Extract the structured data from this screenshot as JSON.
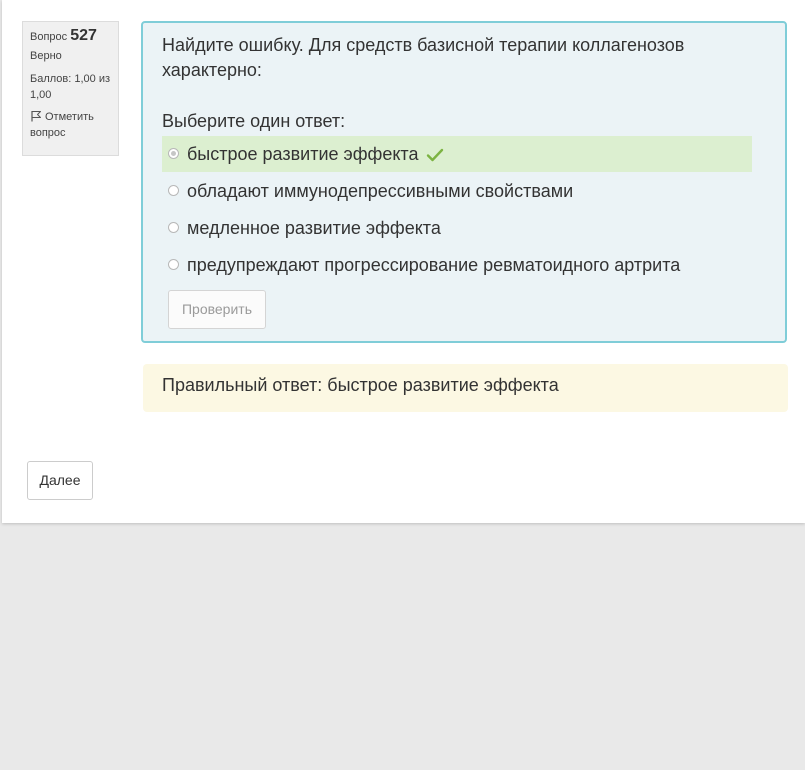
{
  "question_info": {
    "label": "Вопрос",
    "number": "527",
    "state": "Верно",
    "grade": "Баллов: 1,00 из 1,00",
    "flag_label": "Отметить вопрос"
  },
  "question": {
    "text": "Найдите ошибку. Для средств базисной терапии коллагенозов характерно:",
    "prompt": "Выберите один ответ:",
    "answers": [
      {
        "label": "быстрое развитие эффекта",
        "selected": true,
        "correct": true
      },
      {
        "label": "обладают иммунодепрессивными свойствами",
        "selected": false
      },
      {
        "label": "медленное развитие эффекта",
        "selected": false
      },
      {
        "label": "предупреждают прогрессирование ревматоидного артрита",
        "selected": false
      }
    ],
    "check_button": "Проверить"
  },
  "feedback": {
    "right_answer": "Правильный ответ: быстрое развитие эффекта"
  },
  "navigation": {
    "next_button": "Далее"
  },
  "colors": {
    "formulation_bg": "#ebf3f6",
    "formulation_border": "#7fcdd8",
    "correct_bg": "#dcefd0",
    "check_mark": "#7cb342",
    "outcome_bg": "#fcf8e3"
  },
  "icons": {
    "flag": "flag-icon",
    "correct": "check-icon"
  }
}
